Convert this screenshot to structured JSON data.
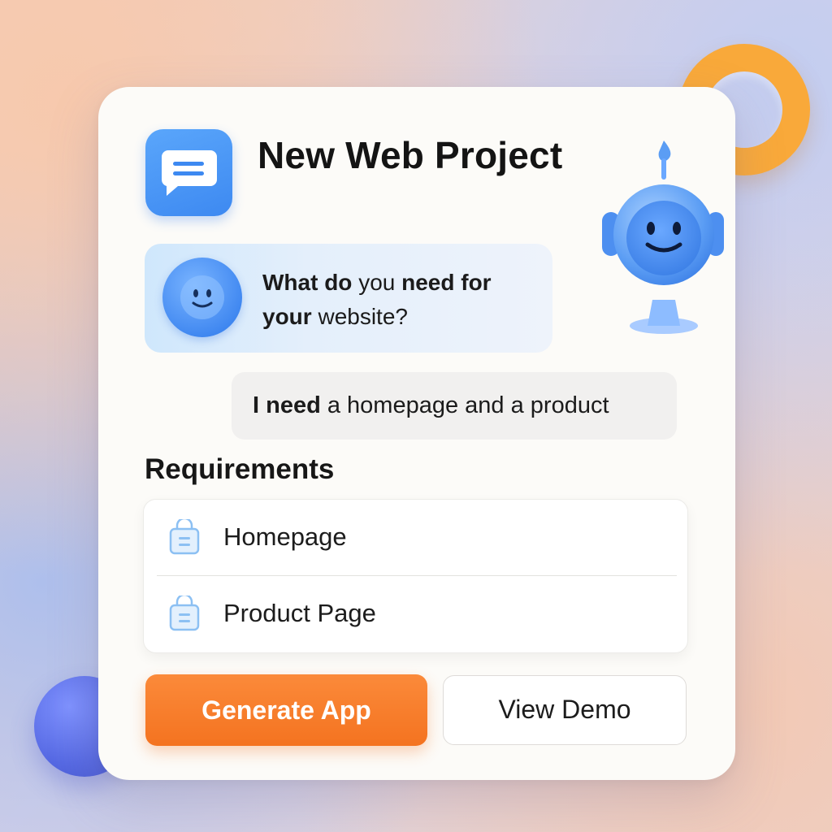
{
  "header": {
    "title": "New Web Project",
    "icon": "chat-bubble-icon"
  },
  "assistant_message": {
    "part1": "What do",
    "part2": " you ",
    "part3": "need for",
    "part4": "your",
    "part5": " website?"
  },
  "user_message": {
    "bold": "I need",
    "rest": " a homepage and a product"
  },
  "requirements": {
    "heading": "Requirements",
    "items": [
      {
        "label": "Homepage",
        "icon": "page-icon"
      },
      {
        "label": "Product Page",
        "icon": "page-icon"
      }
    ]
  },
  "actions": {
    "primary_label": "Generate App",
    "secondary_label": "View Demo"
  },
  "colors": {
    "accent_orange": "#f47320",
    "accent_blue": "#3d89f1",
    "card_bg": "#fcfbf8"
  }
}
